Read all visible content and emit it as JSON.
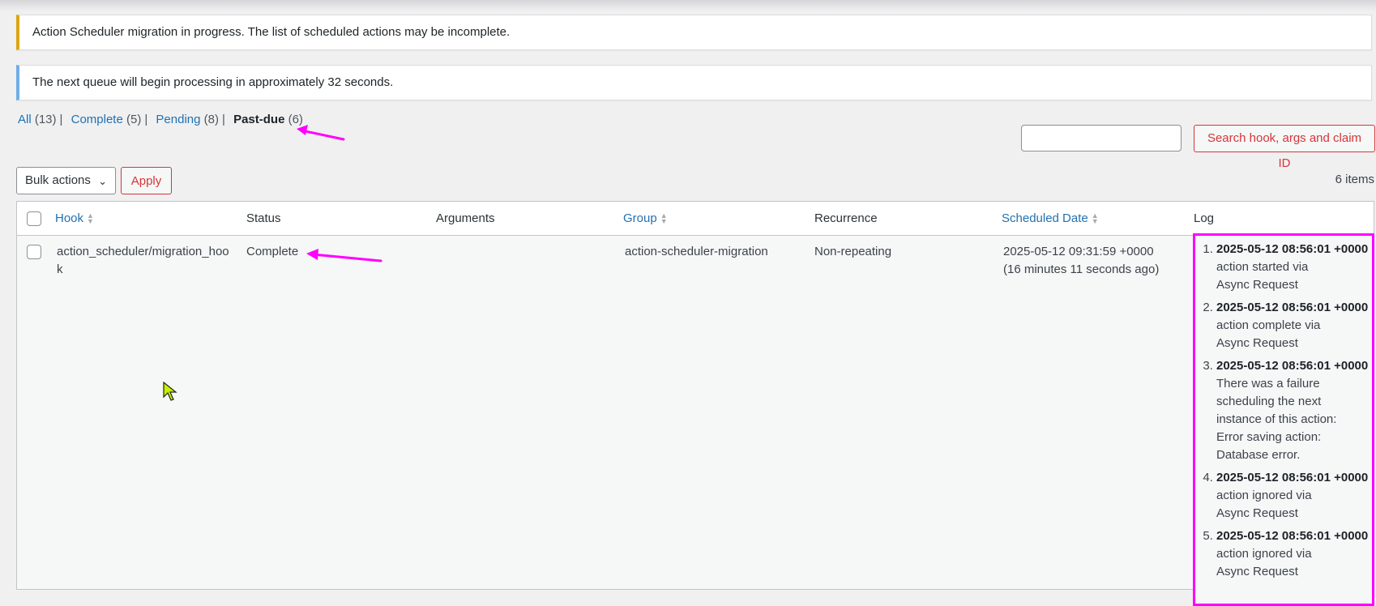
{
  "notices": {
    "warning": "Action Scheduler migration in progress. The list of scheduled actions may be incomplete.",
    "info": "The next queue will begin processing in approximately 32 seconds."
  },
  "filters": [
    {
      "label": "All",
      "count": "(13)",
      "current": false
    },
    {
      "label": "Complete",
      "count": "(5)",
      "current": false
    },
    {
      "label": "Pending",
      "count": "(8)",
      "current": false
    },
    {
      "label": "Past-due",
      "count": "(6)",
      "current": true
    }
  ],
  "search": {
    "value": "",
    "button_label": "Search hook, args and claim ID"
  },
  "bulk": {
    "selected": "Bulk actions",
    "apply_label": "Apply"
  },
  "items_count": "6 items",
  "columns": {
    "hook": "Hook",
    "status": "Status",
    "arguments": "Arguments",
    "group": "Group",
    "recurrence": "Recurrence",
    "scheduled_date": "Scheduled Date",
    "log": "Log"
  },
  "rows": [
    {
      "hook_line1": "action_scheduler/migration_hoo",
      "hook_line2": "k",
      "status": "Complete",
      "arguments": "",
      "group": "action-scheduler-migration",
      "recurrence": "Non-repeating",
      "scheduled_date": "2025-05-12 09:31:59 +0000",
      "scheduled_relative": "(16 minutes 11 seconds ago)",
      "log": [
        {
          "when": "2025-05-12 08:56:01 +0000",
          "lines": [
            "action started via",
            "Async Request"
          ]
        },
        {
          "when": "2025-05-12 08:56:01 +0000",
          "lines": [
            "action complete via",
            "Async Request"
          ]
        },
        {
          "when": "2025-05-12 08:56:01 +0000",
          "lines": [
            "There was a failure",
            "scheduling the next",
            "instance of this action:",
            "Error saving action:",
            "Database error."
          ]
        },
        {
          "when": "2025-05-12 08:56:01 +0000",
          "lines": [
            "action ignored via",
            "Async Request"
          ]
        },
        {
          "when": "2025-05-12 08:56:01 +0000",
          "lines": [
            "action ignored via",
            "Async Request"
          ]
        }
      ]
    }
  ],
  "colors": {
    "annotation": "#ff00ff",
    "link": "#2271b1",
    "warning_border": "#dba617",
    "info_border": "#72aee6"
  },
  "icons": {
    "sort": "sort-arrows-icon",
    "chevron": "chevron-down-icon",
    "cursor": "mouse-cursor-icon",
    "annotation": "annotation-arrow-icon"
  }
}
